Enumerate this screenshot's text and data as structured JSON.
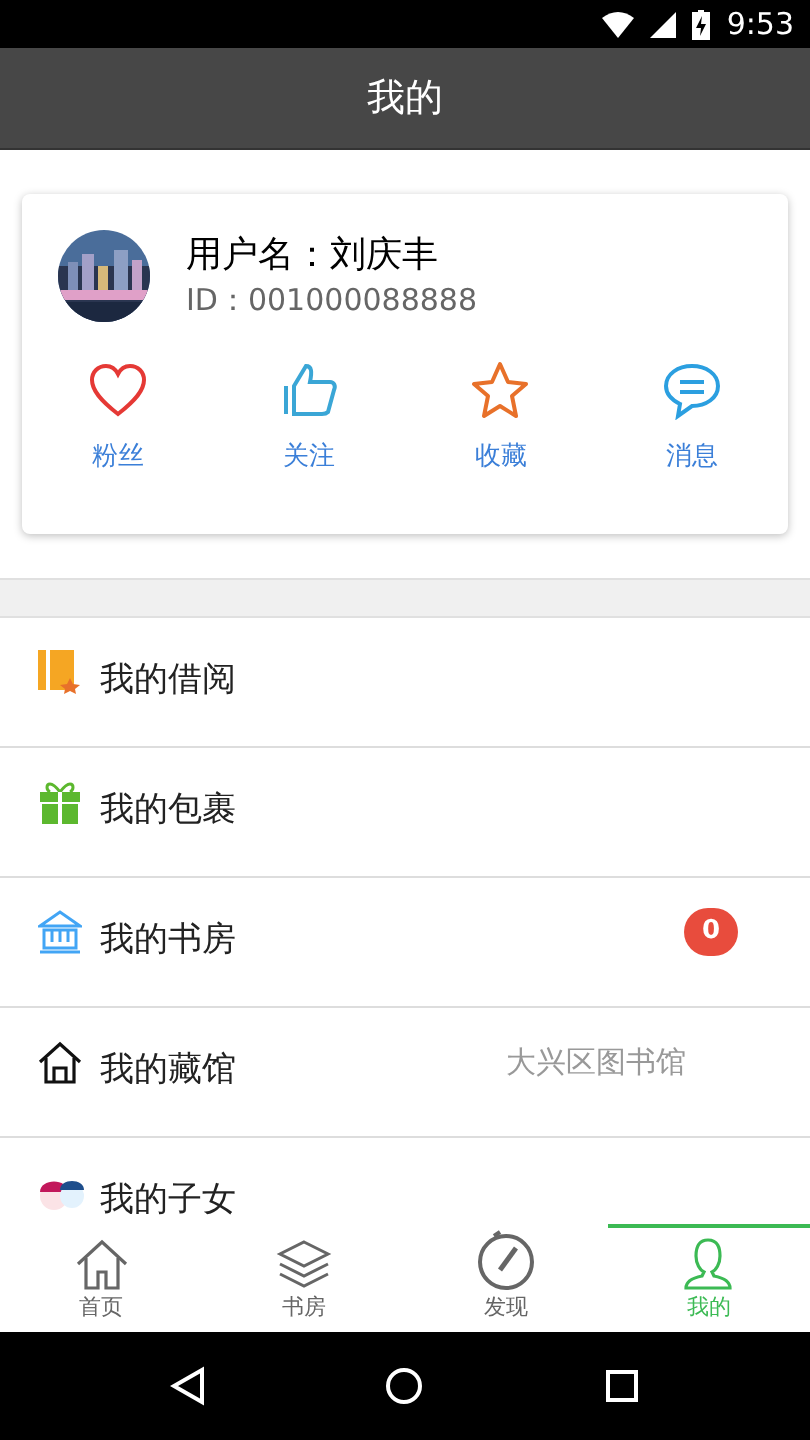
{
  "status_bar": {
    "time": "9:53"
  },
  "header": {
    "title": "我的"
  },
  "profile": {
    "username": "用户名：刘庆丰",
    "id": "ID：001000088888",
    "actions": [
      {
        "label": "粉丝"
      },
      {
        "label": "关注"
      },
      {
        "label": "收藏"
      },
      {
        "label": "消息"
      }
    ]
  },
  "menu": [
    {
      "label": "我的借阅"
    },
    {
      "label": "我的包裹"
    },
    {
      "label": "我的书房",
      "badge": "0"
    },
    {
      "label": "我的藏馆",
      "detail": "大兴区图书馆"
    },
    {
      "label": "我的子女"
    }
  ],
  "tabs": [
    {
      "label": "首页",
      "selected": false
    },
    {
      "label": "书房",
      "selected": false
    },
    {
      "label": "发现",
      "selected": false
    },
    {
      "label": "我的",
      "selected": true
    }
  ]
}
